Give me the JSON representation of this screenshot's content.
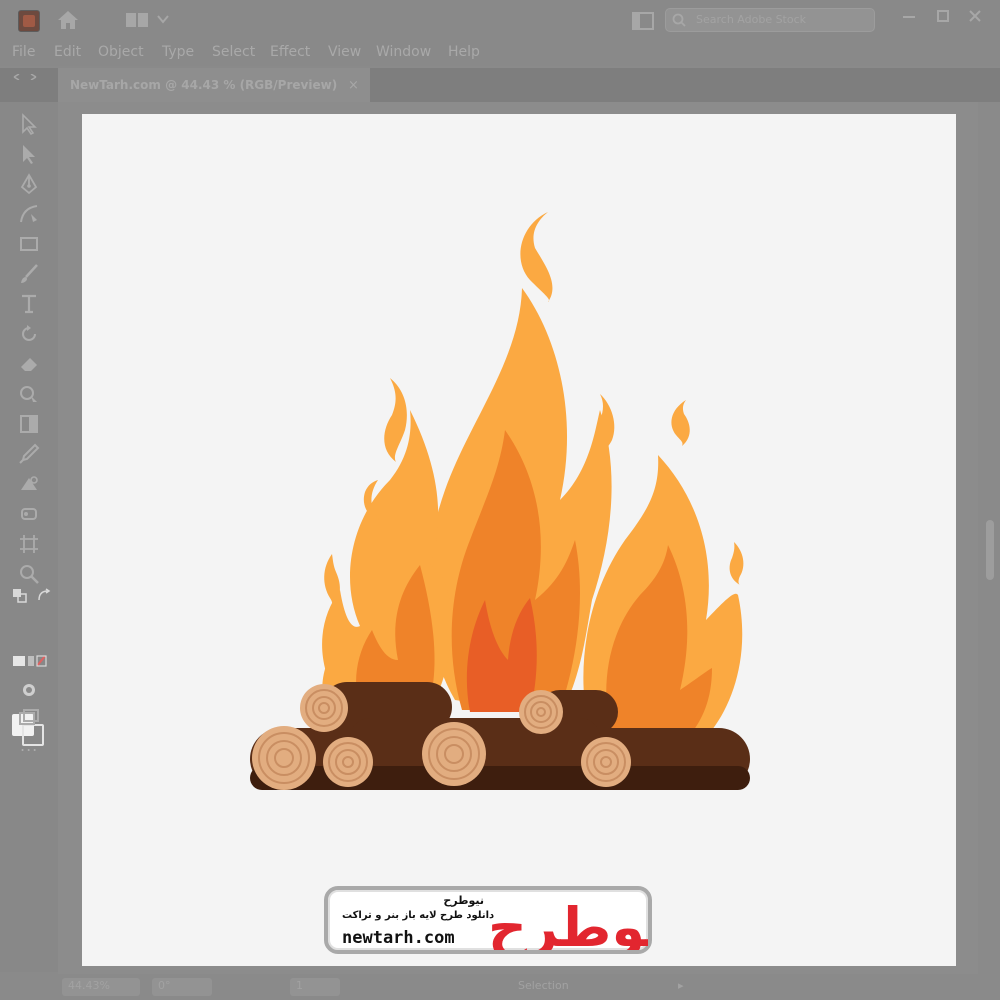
{
  "colors": {
    "flame_outer": "#FBA942",
    "flame_mid": "#EF8329",
    "flame_inner": "#E85E26",
    "log_dark": "#5A2E17",
    "log_shadow": "#3E1E0E",
    "wood_ring": "#E2AD80",
    "wood_core": "#F3C9A0",
    "watermark_red": "#E2262F",
    "artboard": "#F4F4F4"
  },
  "app": {
    "logo_icon": "illustrator-icon",
    "home_icon": "home-icon",
    "search_placeholder": "Search Adobe Stock"
  },
  "menu": [
    "File",
    "Edit",
    "Object",
    "Type",
    "Select",
    "Effect",
    "View",
    "Window",
    "Help"
  ],
  "document_tab": {
    "title": "NewTarh.com @ 44.43 % (RGB/Preview)",
    "close": "×"
  },
  "toolbar": {
    "tools": [
      "selection-tool-icon",
      "direct-selection-tool-icon",
      "pen-tool-icon",
      "curvature-tool-icon",
      "rectangle-tool-icon",
      "paintbrush-tool-icon",
      "type-tool-icon",
      "rotate-tool-icon",
      "eraser-tool-icon",
      "shape-builder-tool-icon",
      "gradient-tool-icon",
      "eyedropper-tool-icon",
      "blend-tool-icon",
      "symbol-sprayer-tool-icon",
      "artboard-tool-icon",
      "zoom-tool-icon"
    ],
    "more": "..."
  },
  "status": {
    "zoom": "44.43%",
    "rotation": "0°",
    "artboard": "1",
    "tool": "Selection"
  },
  "watermark": {
    "brand_fa": "نیوطرح",
    "logo_text": "نیوطرح",
    "tagline": "دانلود طرح لایه باز بنر و تراکت",
    "url": "newtarh.com"
  }
}
